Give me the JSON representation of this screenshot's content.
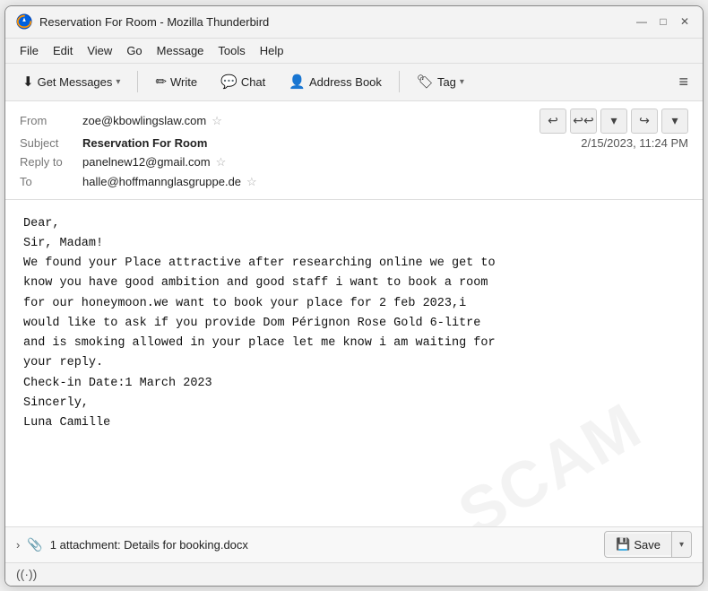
{
  "window": {
    "title": "Reservation For Room - Mozilla Thunderbird"
  },
  "titlebar": {
    "title": "Reservation For Room - Mozilla Thunderbird",
    "minimize": "—",
    "maximize": "□",
    "close": "✕"
  },
  "menubar": {
    "items": [
      "File",
      "Edit",
      "View",
      "Go",
      "Message",
      "Tools",
      "Help"
    ]
  },
  "toolbar": {
    "get_messages": "Get Messages",
    "write": "Write",
    "chat": "Chat",
    "address_book": "Address Book",
    "tag": "Tag"
  },
  "email": {
    "from_label": "From",
    "from_value": "zoe@kbowlingslaw.com",
    "subject_label": "Subject",
    "subject_value": "Reservation For Room",
    "date": "2/15/2023, 11:24 PM",
    "reply_to_label": "Reply to",
    "reply_to_value": "panelnew12@gmail.com",
    "to_label": "To",
    "to_value": "halle@hoffmannglasgruppe.de",
    "body": "Dear,\nSir, Madam!\nWe found your Place attractive after researching online we get to\nknow you have good ambition and good staff i want to book a room\nfor our honeymoon.we want to book your place for 2 feb 2023,i\nwould like to ask if you provide Dom Pérignon Rose Gold 6-litre\nand is smoking allowed in your place let me know i am waiting for\nyour reply.\nCheck-in Date:1 March 2023\nSincerly,\nLuna Camille"
  },
  "attachment": {
    "label": "1 attachment: Details for booking.docx",
    "save": "Save"
  },
  "statusbar": {
    "icon": "((·))"
  }
}
